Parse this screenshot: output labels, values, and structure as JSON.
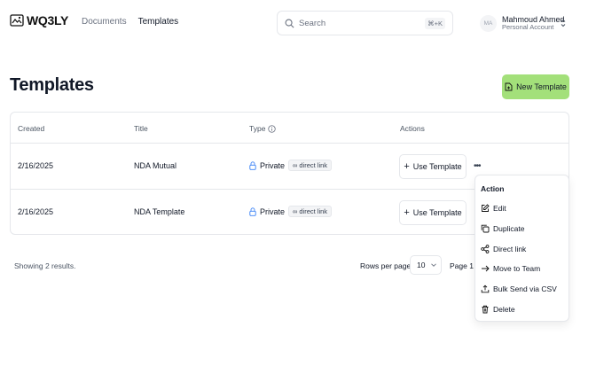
{
  "brand": {
    "name": "WQ3LY"
  },
  "nav": {
    "documents": "Documents",
    "templates": "Templates"
  },
  "search": {
    "placeholder": "Search",
    "shortcut": "⌘+K"
  },
  "user": {
    "initials": "MA",
    "name": "Mahmoud Ahmed",
    "account": "Personal Account"
  },
  "page": {
    "title": "Templates",
    "new_button": "New Template"
  },
  "table": {
    "columns": [
      "Created",
      "Title",
      "Type",
      "Actions"
    ],
    "rows": [
      {
        "created": "2/16/2025",
        "title": "NDA Mutual",
        "visibility": "Private",
        "badge": "direct link",
        "action": "Use Template"
      },
      {
        "created": "2/16/2025",
        "title": "NDA Template",
        "visibility": "Private",
        "badge": "direct link",
        "action": "Use Template"
      }
    ]
  },
  "footer": {
    "showing": "Showing 2 results.",
    "rows_per_page_label": "Rows per page",
    "rows_per_page_value": "10",
    "page_of": "Page 1 o"
  },
  "menu": {
    "title": "Action",
    "items": [
      {
        "label": "Edit",
        "icon": "edit-icon"
      },
      {
        "label": "Duplicate",
        "icon": "duplicate-icon"
      },
      {
        "label": "Direct link",
        "icon": "share-icon"
      },
      {
        "label": "Move to Team",
        "icon": "arrow-right-icon"
      },
      {
        "label": "Bulk Send via CSV",
        "icon": "upload-icon"
      },
      {
        "label": "Delete",
        "icon": "trash-icon"
      }
    ]
  },
  "colors": {
    "accent": "#a3e07a",
    "border": "#e5e7eb",
    "muted": "#6b7280",
    "lock": "#3b82f6"
  }
}
